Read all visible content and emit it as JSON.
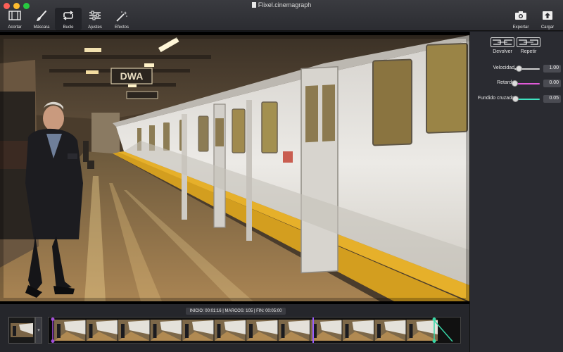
{
  "window": {
    "title": "Flixel.cinemagraph"
  },
  "toolbar": {
    "tools": [
      {
        "label": "Acortar",
        "icon": "crop-film-icon"
      },
      {
        "label": "Máscara",
        "icon": "brush-icon"
      },
      {
        "label": "Bucle",
        "icon": "loop-icon",
        "active": true
      },
      {
        "label": "Ajustes",
        "icon": "sliders-icon"
      },
      {
        "label": "Efectos",
        "icon": "magic-wand-icon"
      }
    ],
    "export_label": "Exportar",
    "upload_label": "Cargar"
  },
  "video": {
    "sign_text": "DWA"
  },
  "panel": {
    "reverse_label": "Devolver",
    "repeat_label": "Repetir",
    "sliders": [
      {
        "label": "Velocidad",
        "value": "1.00",
        "color": "#cfcfcf",
        "level": 0.17
      },
      {
        "label": "Retardo",
        "value": "0.00",
        "color": "#e05ad8",
        "level": 0.0
      },
      {
        "label": "Fundido cruzado",
        "value": "0.05",
        "color": "#3fe3c1",
        "level": 0.03
      }
    ]
  },
  "timeline": {
    "info": "INICIO: 00:01:16 | MARCOS: 105 | FIN: 00:05:00",
    "start_handle_color": "#a24fd8",
    "end_handle_color": "#37d6a7",
    "playhead_color": "#9b5cff",
    "frame_count": 12
  }
}
